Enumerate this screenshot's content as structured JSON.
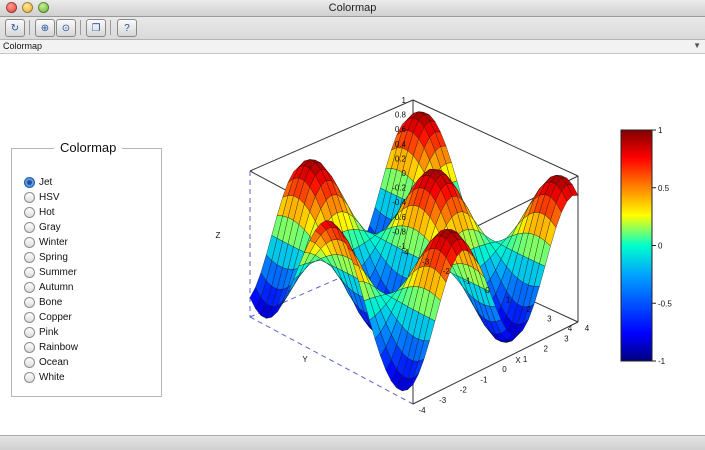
{
  "window": {
    "title": "Colormap"
  },
  "toolbar": {
    "icons": [
      "rotate-icon",
      "zoom-in-icon",
      "zoom-fit-icon",
      "undock-icon",
      "help-icon"
    ]
  },
  "pathbar": {
    "label": "Colormap"
  },
  "panel": {
    "title": "Colormap",
    "selected": "Jet",
    "options": [
      "Jet",
      "HSV",
      "Hot",
      "Gray",
      "Winter",
      "Spring",
      "Summer",
      "Autumn",
      "Bone",
      "Copper",
      "Pink",
      "Rainbow",
      "Ocean",
      "White"
    ]
  },
  "plot": {
    "z_label": "Z",
    "x_label": "X",
    "y_label": "Y",
    "z_ticks": [
      "1",
      "0.8",
      "0.6",
      "0.4",
      "0.2",
      "0",
      "-0.2",
      "-0.4",
      "-0.6",
      "-0.8",
      "-1"
    ],
    "y_ticks": [
      "-4",
      "-3",
      "-2",
      "-1",
      "0",
      "1",
      "2",
      "3",
      "4"
    ],
    "x_ticks": [
      "4",
      "3",
      "2",
      "1",
      "0",
      "-1",
      "-2",
      "-3",
      "-4"
    ],
    "colorbar_ticks": [
      "1",
      "0.5",
      "0",
      "-0.5",
      "-1"
    ],
    "colormap": "Jet"
  }
}
